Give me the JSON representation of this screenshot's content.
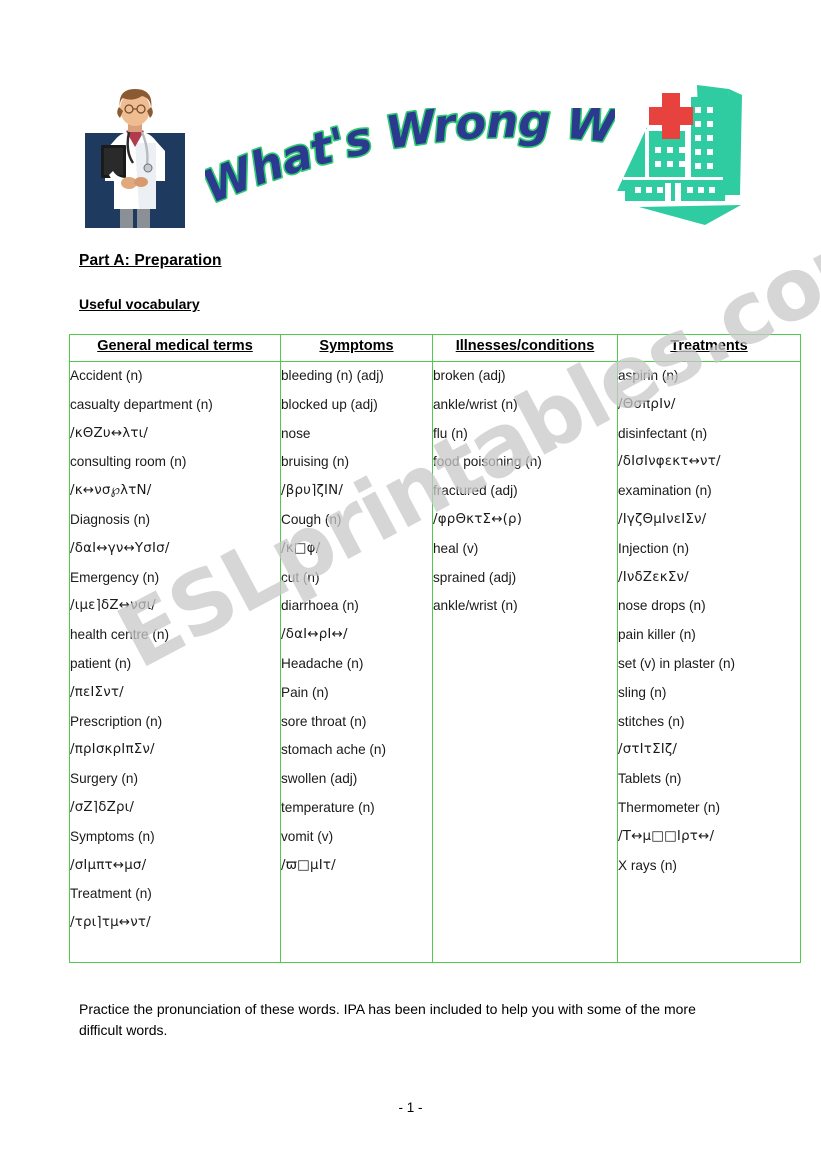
{
  "header": {
    "title": "What's Wrong With Me?",
    "title_fill_color": "#2B3A8F",
    "title_outline_color": "#2ECC71",
    "doctor_image_alt": "doctor-clipart",
    "hospital_image_alt": "hospital-clipart",
    "hospital_color": "#2ECCA0",
    "cross_color": "#E8423F"
  },
  "watermark": {
    "text": "ESLprintables.com",
    "color": "#c9c9c9"
  },
  "section": {
    "part_title": "Part A: Preparation",
    "subtitle": "Useful vocabulary"
  },
  "table": {
    "border_color": "#4fca4f",
    "columns": [
      {
        "header": "General medical terms",
        "items": [
          {
            "text": "Accident (n)",
            "ipa": false
          },
          {
            "text": "casualty department (n)",
            "ipa": false
          },
          {
            "text": "/κΘΖυ↔λτι/",
            "ipa": true
          },
          {
            "text": "consulting room (n)",
            "ipa": false
          },
          {
            "text": "/κ↔νσ℘λτΝ/",
            "ipa": true
          },
          {
            "text": "Diagnosis (n)",
            "ipa": false
          },
          {
            "text": "/δαΙ↔γν↔ΥσΙσ/",
            "ipa": true
          },
          {
            "text": "Emergency (n)",
            "ipa": false
          },
          {
            "text": "/ιμε⌉δΖ↔νσι/",
            "ipa": true
          },
          {
            "text": "health centre (n)",
            "ipa": false
          },
          {
            "text": "patient (n)",
            "ipa": false
          },
          {
            "text": "/πεΙΣντ/",
            "ipa": true
          },
          {
            "text": "Prescription (n)",
            "ipa": false
          },
          {
            "text": "/πρΙσκρΙπΣν/",
            "ipa": true
          },
          {
            "text": "Surgery (n)",
            "ipa": false
          },
          {
            "text": "/σΖ⌉δΖρι/",
            "ipa": true
          },
          {
            "text": "Symptoms (n)",
            "ipa": false
          },
          {
            "text": "/σΙμπτ↔μσ/",
            "ipa": true
          },
          {
            "text": "Treatment (n)",
            "ipa": false
          },
          {
            "text": "/τρι⌉τμ↔ντ/",
            "ipa": true
          }
        ]
      },
      {
        "header": "Symptoms",
        "items": [
          {
            "text": "bleeding (n) (adj)",
            "ipa": false
          },
          {
            "text": "blocked up (adj)",
            "ipa": false
          },
          {
            "text": "nose",
            "ipa": false
          },
          {
            "text": "bruising (n)",
            "ipa": false
          },
          {
            "text": "/βρυ⌉ζΙΝ/",
            "ipa": true
          },
          {
            "text": "Cough (n)",
            "ipa": false
          },
          {
            "text": "/κ□φ/",
            "ipa": true
          },
          {
            "text": "cut (n)",
            "ipa": false
          },
          {
            "text": "diarrhoea (n)",
            "ipa": false
          },
          {
            "text": "/δαΙ↔ρΙ↔/",
            "ipa": true
          },
          {
            "text": "Headache (n)",
            "ipa": false
          },
          {
            "text": "Pain (n)",
            "ipa": false
          },
          {
            "text": "sore throat (n)",
            "ipa": false
          },
          {
            "text": "stomach ache (n)",
            "ipa": false
          },
          {
            "text": "swollen (adj)",
            "ipa": false
          },
          {
            "text": "temperature (n)",
            "ipa": false
          },
          {
            "text": "vomit (v)",
            "ipa": false
          },
          {
            "text": "/ϖ□μΙτ/",
            "ipa": true
          }
        ]
      },
      {
        "header": "Illnesses/conditions",
        "items": [
          {
            "text": "broken (adj)",
            "ipa": false
          },
          {
            "text": "ankle/wrist (n)",
            "ipa": false
          },
          {
            "text": "flu (n)",
            "ipa": false
          },
          {
            "text": "food poisoning (n)",
            "ipa": false
          },
          {
            "text": "fractured (adj)",
            "ipa": false
          },
          {
            "text": "/φρΘκτΣ↔(ρ)",
            "ipa": true
          },
          {
            "text": "heal (v)",
            "ipa": false
          },
          {
            "text": "sprained (adj)",
            "ipa": false
          },
          {
            "text": "ankle/wrist (n)",
            "ipa": false
          }
        ]
      },
      {
        "header": "Treatments",
        "items": [
          {
            "text": "aspirin (n)",
            "ipa": false
          },
          {
            "text": "/ΘσπρΙν/",
            "ipa": true
          },
          {
            "text": "disinfectant (n)",
            "ipa": false
          },
          {
            "text": "/δΙσΙνφεκτ↔ντ/",
            "ipa": true
          },
          {
            "text": "examination (n)",
            "ipa": false
          },
          {
            "text": "/ΙγζΘμΙνεΙΣν/",
            "ipa": true
          },
          {
            "text": "Injection (n)",
            "ipa": false
          },
          {
            "text": "/ΙνδΖεκΣν/",
            "ipa": true
          },
          {
            "text": "nose drops (n)",
            "ipa": false
          },
          {
            "text": "pain killer (n)",
            "ipa": false
          },
          {
            "text": "set (v) in plaster (n)",
            "ipa": false
          },
          {
            "text": "sling (n)",
            "ipa": false
          },
          {
            "text": "stitches (n)",
            "ipa": false
          },
          {
            "text": "/στΙτΣΙζ/",
            "ipa": true
          },
          {
            "text": "Tablets (n)",
            "ipa": false
          },
          {
            "text": "Thermometer (n)",
            "ipa": false
          },
          {
            "text": "/Τ↔μ□□Ιρτ↔/",
            "ipa": true
          },
          {
            "text": "X rays (n)",
            "ipa": false
          }
        ]
      }
    ]
  },
  "footer": {
    "practice_note": "Practice the pronunciation of these words.  IPA has been included to help you with some of the more difficult words.",
    "page_number": "- 1 -"
  }
}
